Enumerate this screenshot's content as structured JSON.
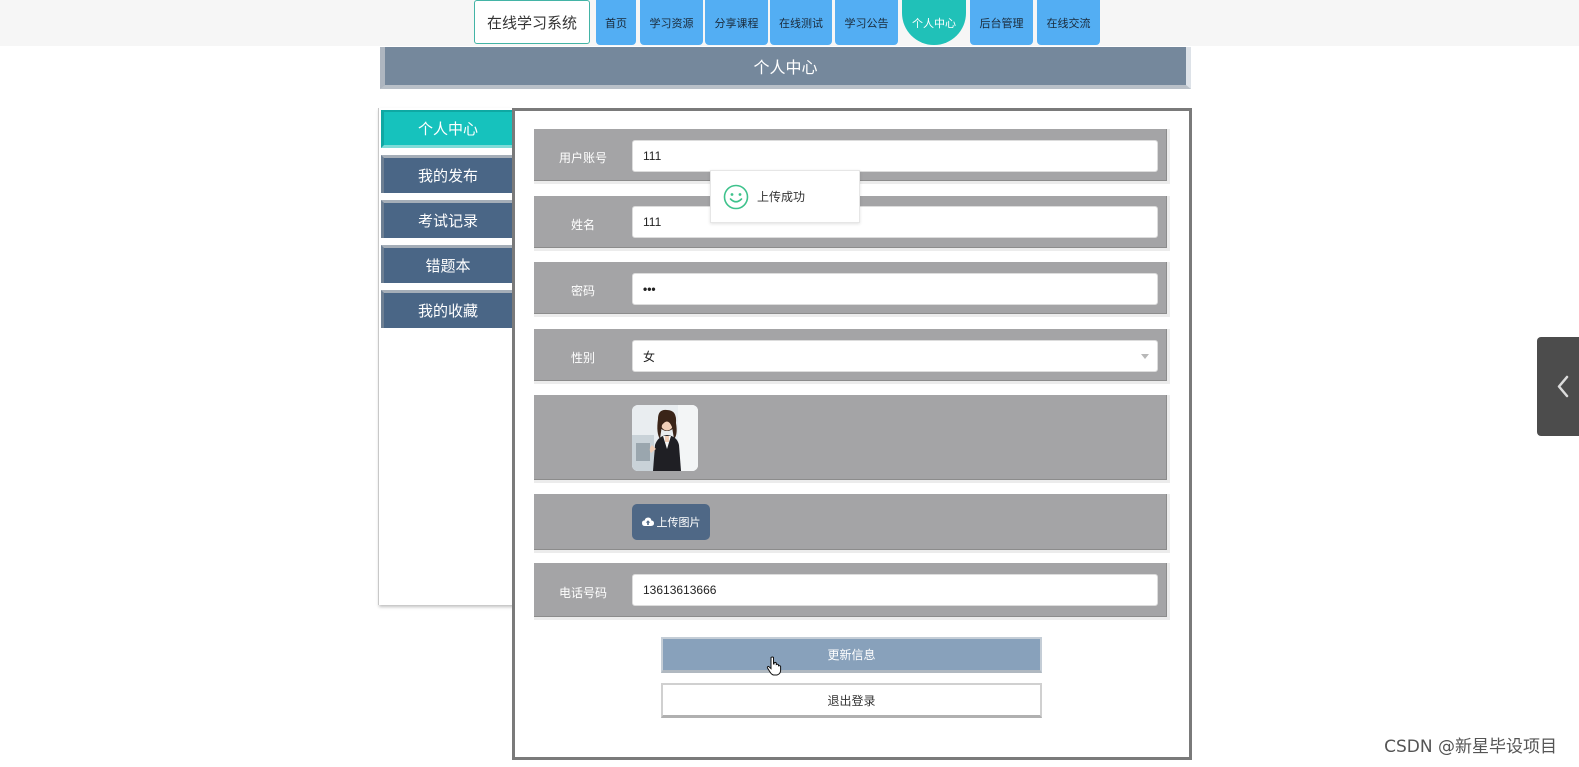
{
  "topnav": {
    "brand": "在线学习系统",
    "items": [
      {
        "label": "首页"
      },
      {
        "label": "学习资源"
      },
      {
        "label": "分享课程"
      },
      {
        "label": "在线测试"
      },
      {
        "label": "学习公告"
      },
      {
        "label": "个人中心",
        "active": true
      },
      {
        "label": "后台管理"
      },
      {
        "label": "在线交流"
      }
    ]
  },
  "page": {
    "title": "个人中心"
  },
  "sidebar": {
    "items": [
      {
        "label": "个人中心",
        "active": true
      },
      {
        "label": "我的发布"
      },
      {
        "label": "考试记录"
      },
      {
        "label": "错题本"
      },
      {
        "label": "我的收藏"
      }
    ]
  },
  "form": {
    "account_label": "用户账号",
    "account_value": "111",
    "name_label": "姓名",
    "name_value": "111",
    "password_label": "密码",
    "password_value": "•••",
    "gender_label": "性别",
    "gender_value": "女",
    "upload_label": "上传图片",
    "phone_label": "电话号码",
    "phone_value": "13613613666"
  },
  "actions": {
    "update_label": "更新信息",
    "logout_label": "退出登录"
  },
  "toast": {
    "message": "上传成功"
  },
  "watermark": "CSDN @新星毕设项目",
  "colors": {
    "nav_blue": "#53aef3",
    "active_teal": "#20c1b8",
    "sidebar_slate": "#4a6686",
    "row_gray": "#a4a4a6"
  }
}
